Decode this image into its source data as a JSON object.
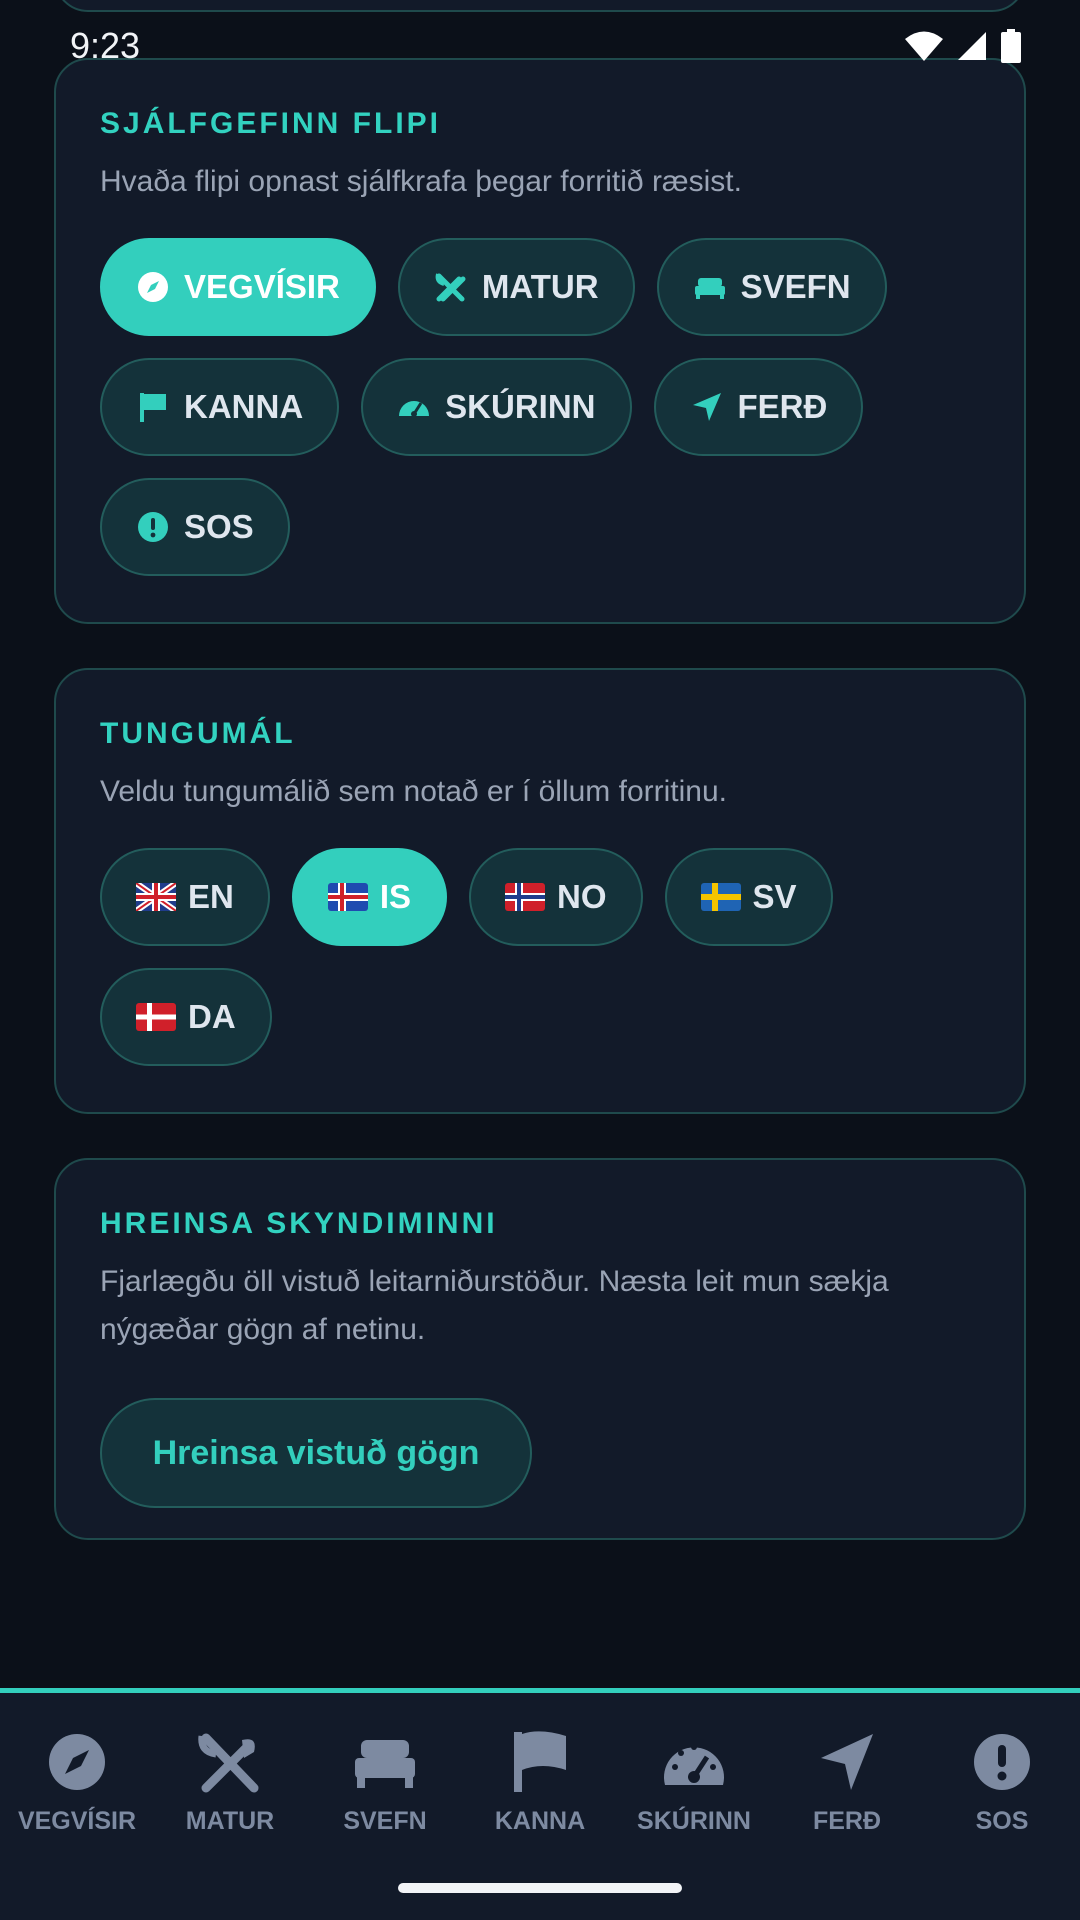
{
  "status_bar": {
    "time": "9:23"
  },
  "default_tab": {
    "title": "SJÁLFGEFINN FLIPI",
    "description": "Hvaða flipi opnast sjálfkrafa þegar forritið ræsist.",
    "options": [
      {
        "label": "VEGVÍSIR",
        "icon": "compass-icon",
        "selected": true
      },
      {
        "label": "MATUR",
        "icon": "utensils-icon",
        "selected": false
      },
      {
        "label": "SVEFN",
        "icon": "bed-icon",
        "selected": false
      },
      {
        "label": "KANNA",
        "icon": "flag-icon",
        "selected": false
      },
      {
        "label": "SKÚRINN",
        "icon": "gauge-icon",
        "selected": false
      },
      {
        "label": "FERÐ",
        "icon": "navigation-arrow-icon",
        "selected": false
      },
      {
        "label": "SOS",
        "icon": "alert-icon",
        "selected": false
      }
    ]
  },
  "language": {
    "title": "TUNGUMÁL",
    "description": "Veldu tungumálið sem notað er í öllum forritinu.",
    "options": [
      {
        "label": "EN",
        "icon": "flag-uk-icon",
        "selected": false
      },
      {
        "label": "IS",
        "icon": "flag-iceland-icon",
        "selected": true
      },
      {
        "label": "NO",
        "icon": "flag-norway-icon",
        "selected": false
      },
      {
        "label": "SV",
        "icon": "flag-sweden-icon",
        "selected": false
      },
      {
        "label": "DA",
        "icon": "flag-denmark-icon",
        "selected": false
      }
    ]
  },
  "cache": {
    "title": "HREINSA SKYNDIMINNI",
    "description": "Fjarlægðu öll vistuð leitarniðurstöður. Næsta leit mun sækja nýgæðar gögn af netinu.",
    "button_label": "Hreinsa vistuð gögn"
  },
  "bottom_nav": {
    "items": [
      {
        "label": "VEGVÍSIR",
        "icon": "compass-icon"
      },
      {
        "label": "MATUR",
        "icon": "utensils-icon"
      },
      {
        "label": "SVEFN",
        "icon": "bed-icon"
      },
      {
        "label": "KANNA",
        "icon": "flag-icon"
      },
      {
        "label": "SKÚRINN",
        "icon": "gauge-icon"
      },
      {
        "label": "FERÐ",
        "icon": "navigation-arrow-icon"
      },
      {
        "label": "SOS",
        "icon": "alert-icon"
      }
    ]
  },
  "colors": {
    "accent": "#33cfbd",
    "background": "#0b1019",
    "card": "#121a29",
    "chip": "#14323a",
    "nav_inactive": "#7d8aa1"
  }
}
